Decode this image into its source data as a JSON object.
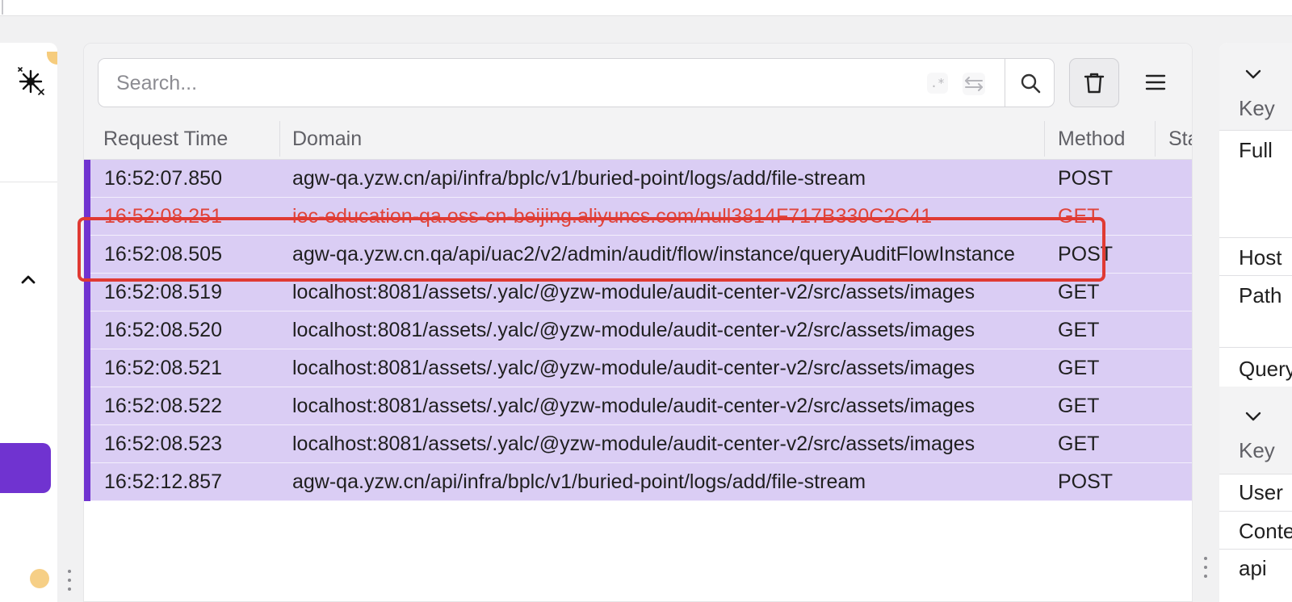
{
  "search": {
    "placeholder": "Search...",
    "regex_symbol": ".*"
  },
  "table": {
    "headers": [
      "Request Time",
      "Domain",
      "Method",
      "Status"
    ],
    "rows": [
      {
        "time": "16:52:07.850",
        "domain": "agw-qa.yzw.cn/api/infra/bplc/v1/buried-point/logs/add/file-stream",
        "method": "POST",
        "state": "normal"
      },
      {
        "time": "16:52:08.251",
        "domain": "iec-education-qa.oss-cn-beijing.aliyuncs.com/null3814F717B330C2C41",
        "method": "GET",
        "state": "error"
      },
      {
        "time": "16:52:08.505",
        "domain": "agw-qa.yzw.cn.qa/api/uac2/v2/admin/audit/flow/instance/queryAuditFlowInstance",
        "method": "POST",
        "state": "highlighted"
      },
      {
        "time": "16:52:08.519",
        "domain": "localhost:8081/assets/.yalc/@yzw-module/audit-center-v2/src/assets/images",
        "method": "GET",
        "state": "normal"
      },
      {
        "time": "16:52:08.520",
        "domain": "localhost:8081/assets/.yalc/@yzw-module/audit-center-v2/src/assets/images",
        "method": "GET",
        "state": "normal"
      },
      {
        "time": "16:52:08.521",
        "domain": "localhost:8081/assets/.yalc/@yzw-module/audit-center-v2/src/assets/images",
        "method": "GET",
        "state": "normal"
      },
      {
        "time": "16:52:08.522",
        "domain": "localhost:8081/assets/.yalc/@yzw-module/audit-center-v2/src/assets/images",
        "method": "GET",
        "state": "normal"
      },
      {
        "time": "16:52:08.523",
        "domain": "localhost:8081/assets/.yalc/@yzw-module/audit-center-v2/src/assets/images",
        "method": "GET",
        "state": "normal"
      },
      {
        "time": "16:52:12.857",
        "domain": "agw-qa.yzw.cn/api/infra/bplc/v1/buried-point/logs/add/file-stream",
        "method": "POST",
        "state": "normal"
      }
    ]
  },
  "detail_panel": {
    "section1": {
      "header": "Key",
      "labels": [
        "Full",
        "Host",
        "Path",
        "Query"
      ]
    },
    "section2": {
      "header": "Key",
      "labels": [
        "User",
        "Content",
        "api"
      ]
    }
  },
  "colors": {
    "row_background": "#dacdf4",
    "row_accent": "#7033d0",
    "error_text": "#e0443a",
    "highlight_border": "#e03a33",
    "nav_button": "#7033d0"
  },
  "icons": [
    "sparkle-icon",
    "chevron-up-icon",
    "regex-icon",
    "swap-icon",
    "search-icon",
    "trash-icon",
    "menu-icon",
    "chevron-down-icon"
  ]
}
